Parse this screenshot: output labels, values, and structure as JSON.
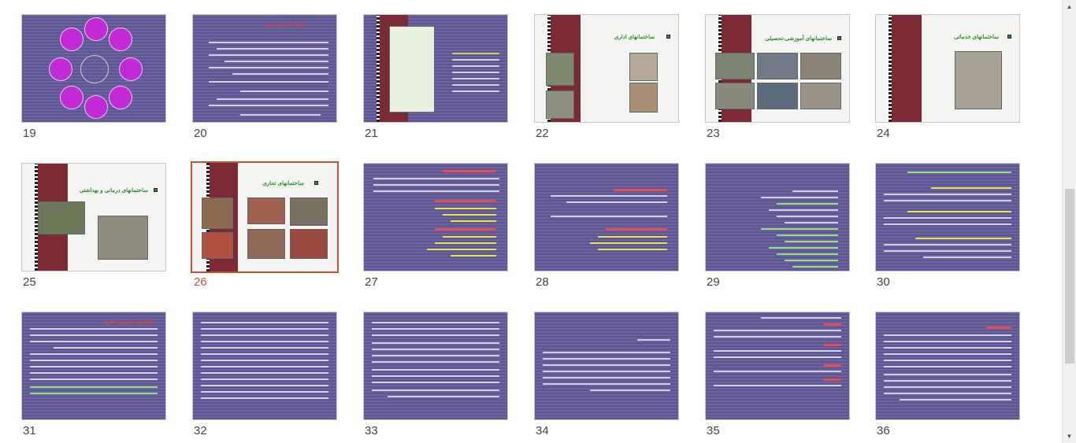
{
  "slides": [
    {
      "number": "19"
    },
    {
      "number": "20",
      "title": "انواع کاربری زمین"
    },
    {
      "number": "21"
    },
    {
      "number": "22",
      "title": "ساختمانهای اداری"
    },
    {
      "number": "23",
      "title": "ساختمانهای آموزشی-تحصیلی"
    },
    {
      "number": "24",
      "title": "ساختمانهای خدماتی"
    },
    {
      "number": "25",
      "title": "ساختمانهای درمانی و بهداشتی"
    },
    {
      "number": "26",
      "title": "ساختمانهای تجاری"
    },
    {
      "number": "27"
    },
    {
      "number": "28"
    },
    {
      "number": "29"
    },
    {
      "number": "30"
    },
    {
      "number": "31",
      "title": "معیارهای کاربری تجاری"
    },
    {
      "number": "32"
    },
    {
      "number": "33"
    },
    {
      "number": "34"
    },
    {
      "number": "35"
    },
    {
      "number": "36"
    }
  ],
  "selected_slide": "26",
  "colors": {
    "selection": "#c8502d",
    "slide_bg": "#5d5691",
    "red_strip": "#7c2a34"
  },
  "scrollbar": {
    "up_icon": "▲",
    "down_icon": "▼"
  }
}
